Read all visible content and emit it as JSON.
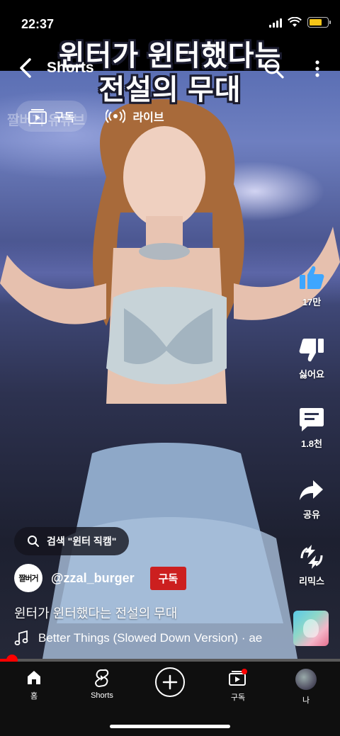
{
  "status_bar": {
    "time": "22:37"
  },
  "header": {
    "overlay_title_line1": "윈터가 윈터했다는",
    "overlay_title_line2": "전설의 무대",
    "title": "Shorts"
  },
  "ghost_text": "짤버거 유튜브",
  "subscribe_row": {
    "subscriptions_label": "구독",
    "live_label": "라이브"
  },
  "actions": {
    "like_count": "17만",
    "dislike_label": "싫어요",
    "comments_count": "1.8천",
    "share_label": "공유",
    "remix_label": "리믹스"
  },
  "search_chip": {
    "text": "검색 \"윈터 직캠\""
  },
  "channel": {
    "avatar_text": "짤버거",
    "handle": "@zzal_burger",
    "subscribe_label": "구독"
  },
  "video": {
    "title": "윈터가 윈터했다는 전설의 무대",
    "music": "Better Things (Slowed Down Version) · ae"
  },
  "progress": {
    "percent": 3.5
  },
  "bottom_nav": {
    "home": "홈",
    "shorts": "Shorts",
    "subscriptions": "구독",
    "me": "나"
  },
  "colors": {
    "accent_red": "#ff0000",
    "subscribe_red": "#cc1f1f",
    "like_blue": "#3ea6ff",
    "battery_yellow": "#f5c518"
  }
}
